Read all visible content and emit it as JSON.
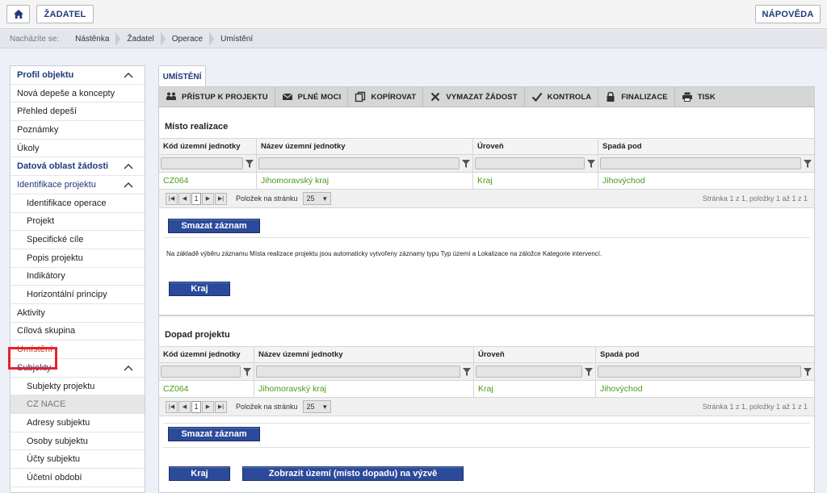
{
  "topbar": {
    "applicant_label": "ŽADATEL",
    "help_label": "NÁPOVĚDA"
  },
  "breadcrumb": {
    "lead": "Nacházíte se:",
    "items": [
      "Nástěnka",
      "Žadatel",
      "Operace",
      "Umístění"
    ]
  },
  "sidebar": {
    "items": [
      {
        "label": "Profil objektu"
      },
      {
        "label": "Nová depeše a koncepty"
      },
      {
        "label": "Přehled depeší"
      },
      {
        "label": "Poznámky"
      },
      {
        "label": "Úkoly"
      },
      {
        "label": "Datová oblast žádosti"
      },
      {
        "label": "Identifikace projektu"
      },
      {
        "label": "Identifikace operace"
      },
      {
        "label": "Projekt"
      },
      {
        "label": "Specifické cíle"
      },
      {
        "label": "Popis projektu"
      },
      {
        "label": "Indikátory"
      },
      {
        "label": "Horizontální principy"
      },
      {
        "label": "Aktivity"
      },
      {
        "label": "Cílová skupina"
      },
      {
        "label": "Umístění"
      },
      {
        "label": "Subjekty"
      },
      {
        "label": "Subjekty projektu"
      },
      {
        "label": "CZ NACE"
      },
      {
        "label": "Adresy subjektu"
      },
      {
        "label": "Osoby subjektu"
      },
      {
        "label": "Účty subjektu"
      },
      {
        "label": "Účetní období"
      }
    ]
  },
  "tab": {
    "label": "UMÍSTĚNÍ"
  },
  "toolbar": {
    "access": "PŘÍSTUP K PROJEKTU",
    "power": "PLNÉ MOCI",
    "copy": "KOPÍROVAT",
    "delete": "VYMAZAT ŽÁDOST",
    "check": "KONTROLA",
    "finalize": "FINALIZACE",
    "print": "TISK"
  },
  "columns": [
    "Kód územní jednotky",
    "Název územní jednotky",
    "Úroveň",
    "Spadá pod"
  ],
  "location": {
    "title": "Místo realizace",
    "row": [
      "CZ064",
      "Jihomoravský kraj",
      "Kraj",
      "Jihovýchod"
    ],
    "page": "1",
    "per_page_label": "Položek na stránku",
    "per_page": "25",
    "page_info": "Stránka 1 z 1, položky 1 až 1 z 1",
    "delete_label": "Smazat záznam",
    "note": "Na základě výběru záznamu Místa realizace projektu jsou automaticky vytvořeny záznamy typu Typ území a Lokalizace na záložce Kategorie intervencí.",
    "level_button": "Kraj"
  },
  "impact": {
    "title": "Dopad projektu",
    "row": [
      "CZ064",
      "Jihomoravský kraj",
      "Kraj",
      "Jihovýchod"
    ],
    "page": "1",
    "per_page_label": "Položek na stránku",
    "per_page": "25",
    "page_info": "Stránka 1 z 1, položky 1 až 1 z 1",
    "delete_label": "Smazat záznam",
    "level_button": "Kraj",
    "show_button": "Zobrazit území (místo dopadu) na výzvě"
  },
  "colors": {
    "accent": "#1f3a7a",
    "button": "#2c4a9a",
    "value_green": "#4a9a1c",
    "highlight": "#e3232b"
  }
}
